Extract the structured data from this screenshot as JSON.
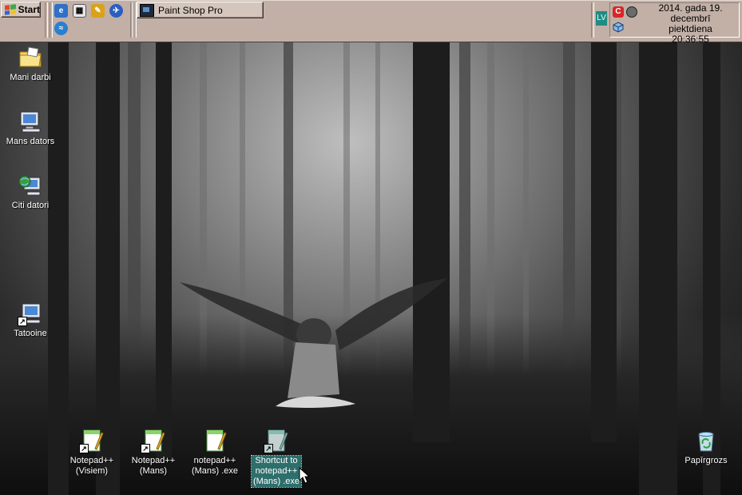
{
  "taskbar": {
    "start_label": "Start",
    "quick_launch": [
      {
        "name": "ie-icon"
      },
      {
        "name": "film-icon"
      },
      {
        "name": "pencil-icon"
      },
      {
        "name": "browser-blue-icon"
      },
      {
        "name": "stack-icon"
      }
    ],
    "tasks": [
      {
        "label": "Paint Shop Pro",
        "icon": "paint-shop-pro-icon"
      }
    ],
    "language": "LV",
    "clock": {
      "date": "2014. gada 19. decembrī",
      "weekday": "piektdiena",
      "time": "20:36:55"
    }
  },
  "desktop": {
    "icons": [
      {
        "label": "Mani darbi",
        "icon": "my-documents-folder-icon"
      },
      {
        "label": "Mans dators",
        "icon": "my-computer-icon"
      },
      {
        "label": "Citi datori",
        "icon": "network-computers-icon"
      },
      {
        "label": "Tatooine",
        "icon": "shortcut-computer-icon"
      },
      {
        "label_lines": [
          "Notepad++",
          "(Visiem)"
        ],
        "icon": "notepadpp-icon"
      },
      {
        "label_lines": [
          "Notepad++",
          "(Mans)"
        ],
        "icon": "notepadpp-icon"
      },
      {
        "label_lines": [
          "notepad++",
          "(Mans) .exe"
        ],
        "icon": "notepadpp-icon"
      },
      {
        "label_lines": [
          "Shortcut to",
          "notepad++",
          "(Mans) .exe"
        ],
        "icon": "notepadpp-icon",
        "selected": true
      },
      {
        "label": "Papīrgrozs",
        "icon": "recycle-bin-icon"
      }
    ]
  },
  "colors": {
    "taskbar": "#c2b0a6",
    "selection": "#2e6e6b"
  }
}
